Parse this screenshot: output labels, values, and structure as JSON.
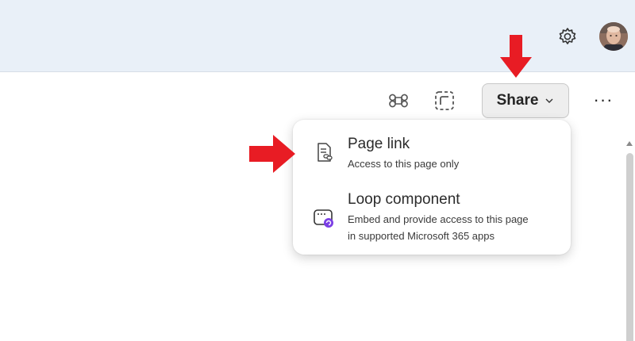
{
  "header": {
    "settings_icon": "gear-icon",
    "avatar_icon": "user-avatar"
  },
  "toolbar": {
    "command_icon": "command-icon",
    "select_icon": "dashed-select-icon",
    "share_label": "Share",
    "more_label": "···"
  },
  "share_menu": {
    "items": [
      {
        "icon": "page-link-icon",
        "title": "Page link",
        "description": "Access to this page only"
      },
      {
        "icon": "loop-component-icon",
        "title": "Loop component",
        "description_line1": "Embed and provide access to this page",
        "description_line2": "in supported Microsoft 365 apps"
      }
    ]
  },
  "annotations": {
    "arrow_color": "#e81c24",
    "accent_purple": "#7b3fe4"
  }
}
